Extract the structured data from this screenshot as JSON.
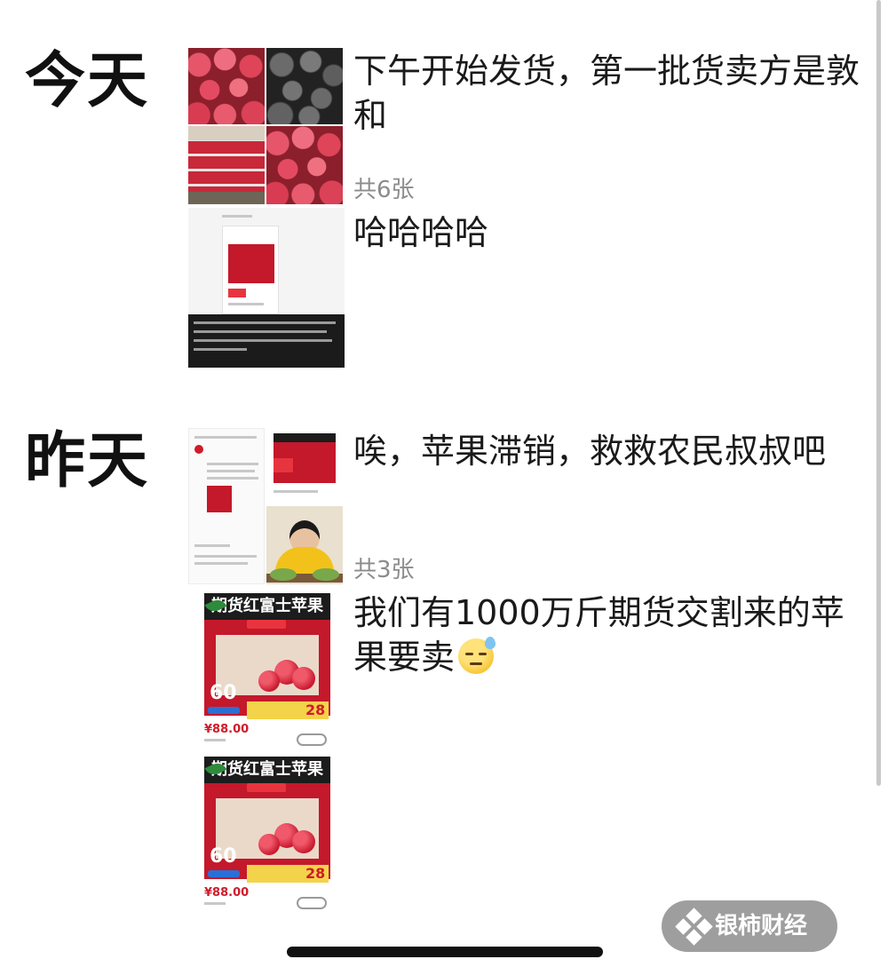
{
  "sections": [
    {
      "date_label": "今天",
      "posts": [
        {
          "text_lines": [
            "下午开始发货，第一批货卖方是敦",
            "和"
          ],
          "photo_count": "共6张"
        },
        {
          "text_lines": [
            "哈哈哈哈"
          ]
        }
      ]
    },
    {
      "date_label": "昨天",
      "posts": [
        {
          "text_lines": [
            "唉，苹果滞销，救救农民叔叔吧"
          ],
          "photo_count": "共3张"
        },
        {
          "text_lines": [
            "我们有1000万斤期货交割来的苹",
            "果要卖"
          ],
          "emoji": "sweat-smile-emoji"
        }
      ]
    }
  ],
  "promo_card": {
    "title": "期货红富士苹果",
    "price": "60",
    "price_tag": "¥88.00",
    "banner_number": "28"
  },
  "watermark": {
    "label": "银柿财经",
    "icon": "diamond-cluster-icon"
  },
  "colors": {
    "apple_red": "#c4182b",
    "muted_text": "#8c8c8c"
  }
}
